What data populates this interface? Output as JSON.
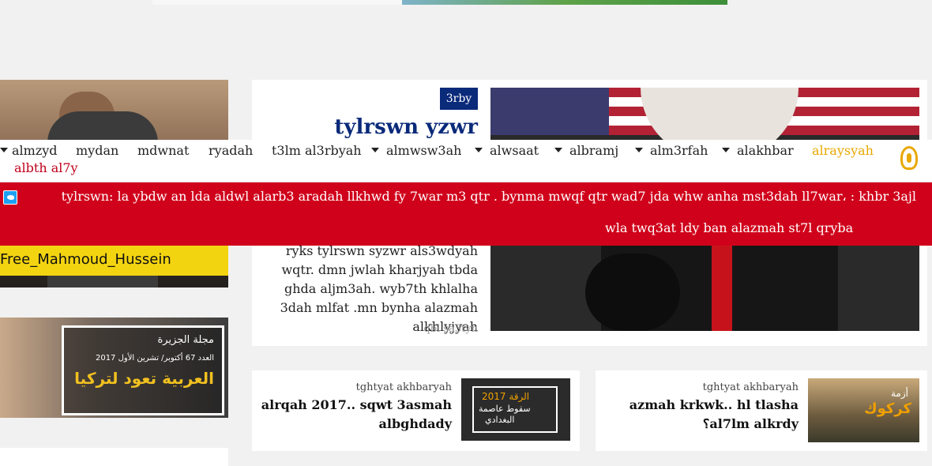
{
  "sidebar": {
    "banner_text": "Free_Mahmoud_Hussein",
    "magazine": {
      "name": "مجلة الجزيرة",
      "issue": "العدد 67 أكتوبر/ تشرين الأول 2017",
      "headline": "العربية تعود لتركيا"
    }
  },
  "feature": {
    "category": "3rby",
    "title": "tylrswn yzwr",
    "description": "ryks tylrswn syzwr als3wdyah wqtr. dmn jwlah kharjyah tbda ghda aljm3ah. wyb7th khlalha 3dah mlfat .mn bynha alazmah alkhlyjyah",
    "time": "qbl sa3tyn"
  },
  "nav": {
    "items": [
      "albth al7y",
      "almzyd",
      "mydan",
      "mdwnat",
      "ryadah",
      "t3lm al3rbyah",
      "almwsw3ah",
      "alwsaat",
      "albramj",
      "alm3rfah",
      "alakhbar",
      "alraysyah"
    ],
    "active_color": "#e8a800"
  },
  "breaking": {
    "line1": "tylrswn: la ybdw an lda aldwl alarb3 aradah llkhwd fy 7war m3 qtr . bynma mwqf qtr wad7 jda whw anha mst3dah ll7war،  : khbr 3ajl",
    "line2": "wla twq3at ldy ban alazmah st7l qryba"
  },
  "cards": [
    {
      "label": "tghtyat akhbaryah",
      "title_line1": "alrqah 2017.. sqwt 3asmah",
      "title_line2": "albghdady",
      "thumb_text1": "الرقة 2017",
      "thumb_text2": "سقوط عاصمة",
      "thumb_text3": "البغدادي"
    },
    {
      "label": "tghtyat akhbaryah",
      "title_line1": "azmah krkwk.. hl tlasha",
      "title_line2": "؟al7lm alkrdy",
      "thumb_text1": "أزمة",
      "thumb_text2": "كركوك"
    }
  ],
  "colors": {
    "brand_blue": "#0a2a7a",
    "breaking_red": "#d0021b",
    "accent_gold": "#e8a800"
  }
}
